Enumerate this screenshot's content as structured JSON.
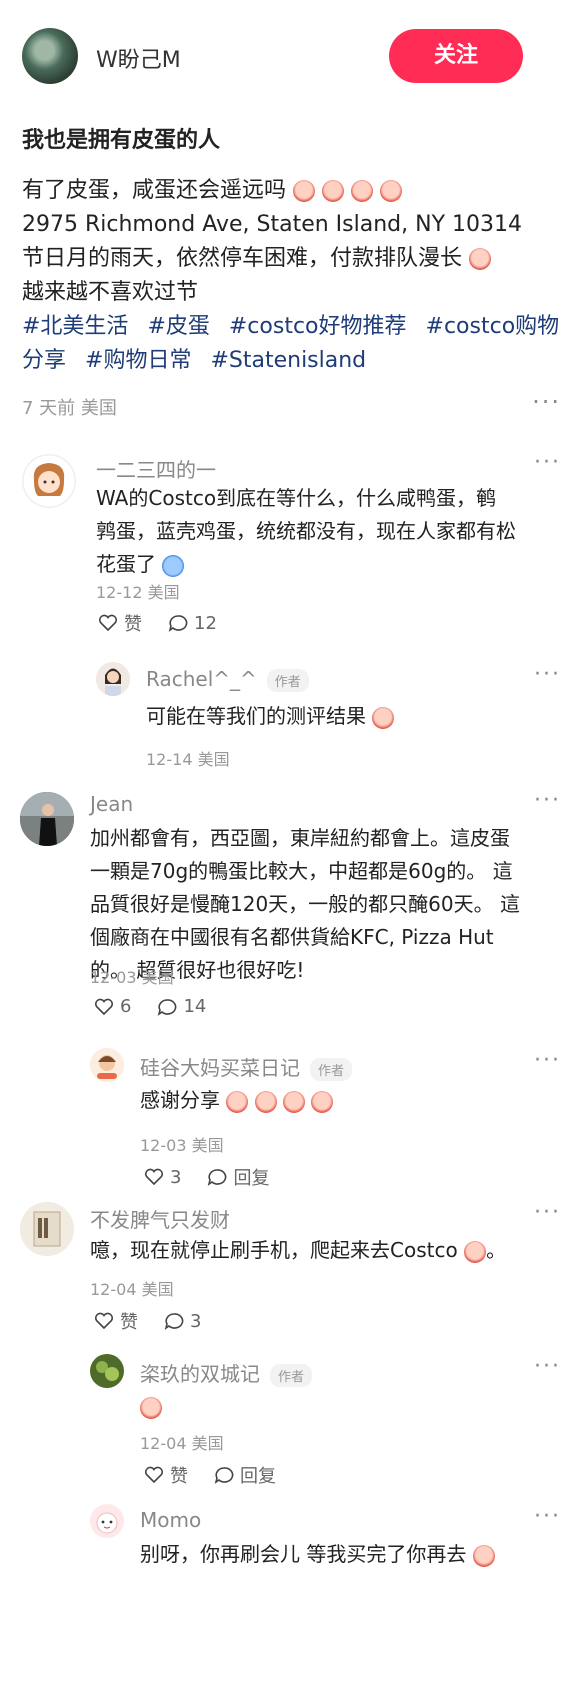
{
  "header": {
    "author": "W盼己M",
    "follow_label": "关注"
  },
  "post": {
    "title": "我也是拥有皮蛋的人",
    "lines": [
      "有了皮蛋，咸蛋还会遥远吗",
      "2975 Richmond Ave, Staten Island, NY 10314",
      "节日月的雨天，依然停车困难，付款排队漫长",
      "越来越不喜欢过节"
    ],
    "tags": [
      "#北美生活",
      "#皮蛋",
      "#costco好物推荐",
      "#costco购物分享",
      "#购物日常",
      "#Statenisland"
    ],
    "meta": "7 天前 美国"
  },
  "comments": [
    {
      "name": "一二三四的一",
      "text": "WA的Costco到底在等什么，什么咸鸭蛋，鹌鹑蛋，蓝壳鸡蛋，统统都没有，现在人家都有松花蛋了",
      "meta": "12-12 美国",
      "likes": "赞",
      "comments": "12",
      "reply": {
        "name": "Rachel^_^",
        "author_tag": "作者",
        "text": "可能在等我们的测评结果",
        "meta": "12-14 美国"
      }
    },
    {
      "name": "Jean",
      "text": "加州都會有，西亞圖，東岸紐約都會上。這皮蛋一顆是70g的鴨蛋比較大，中超都是60g的。 這品質很好是慢醃120天，一般的都只醃60天。 這個廠商在中國很有名都供貨給KFC, Pizza Hut的。 超質很好也很好吃!",
      "meta": "12-03 美国",
      "likes": "6",
      "comments": "14",
      "reply": {
        "name": "硅谷大妈买菜日记",
        "author_tag": "作者",
        "text": "感谢分享",
        "meta": "12-03 美国",
        "likes": "3",
        "reply_label": "回复"
      }
    },
    {
      "name": "不发脾气只发财",
      "text": "噫，现在就停止刷手机，爬起来去Costco",
      "meta": "12-04 美国",
      "likes": "赞",
      "comments": "3",
      "replies": [
        {
          "name": "栥玖的双城记",
          "author_tag": "作者",
          "text": "",
          "meta": "12-04 美国",
          "likes": "赞",
          "reply_label": "回复"
        },
        {
          "name": "Momo",
          "text": "别呀，你再刷会儿 等我买完了你再去"
        }
      ]
    }
  ]
}
